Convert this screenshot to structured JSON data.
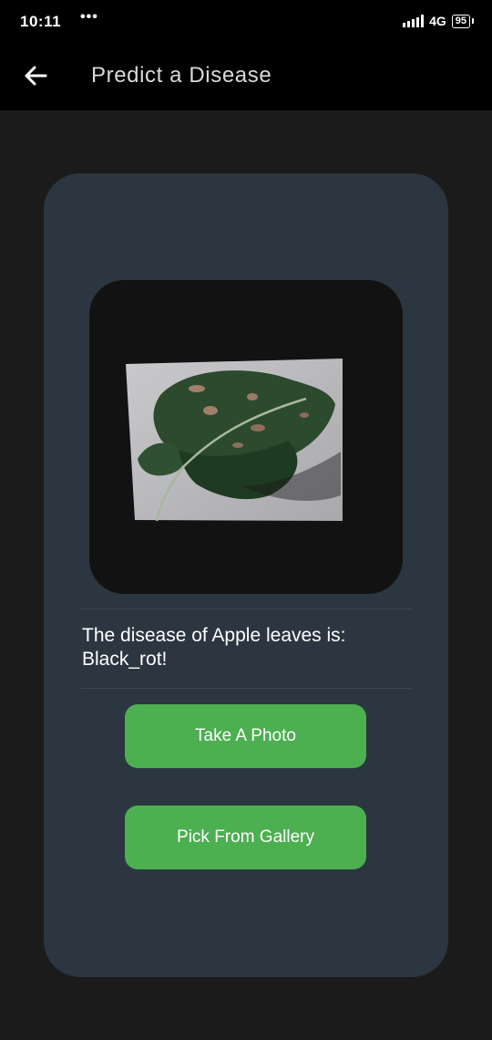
{
  "status": {
    "time": "10:11",
    "dots": "•••",
    "network": "4G",
    "battery": "95"
  },
  "app_bar": {
    "title": "Predict a Disease",
    "back_icon": "arrow-left-icon"
  },
  "result": {
    "text": "The disease of Apple leaves is: Black_rot!"
  },
  "buttons": {
    "take_photo": "Take A Photo",
    "pick_gallery": "Pick From Gallery"
  },
  "colors": {
    "accent": "#4caf50",
    "card": "#2b3640",
    "background": "#1b1b1b",
    "app_bar": "#000000"
  }
}
